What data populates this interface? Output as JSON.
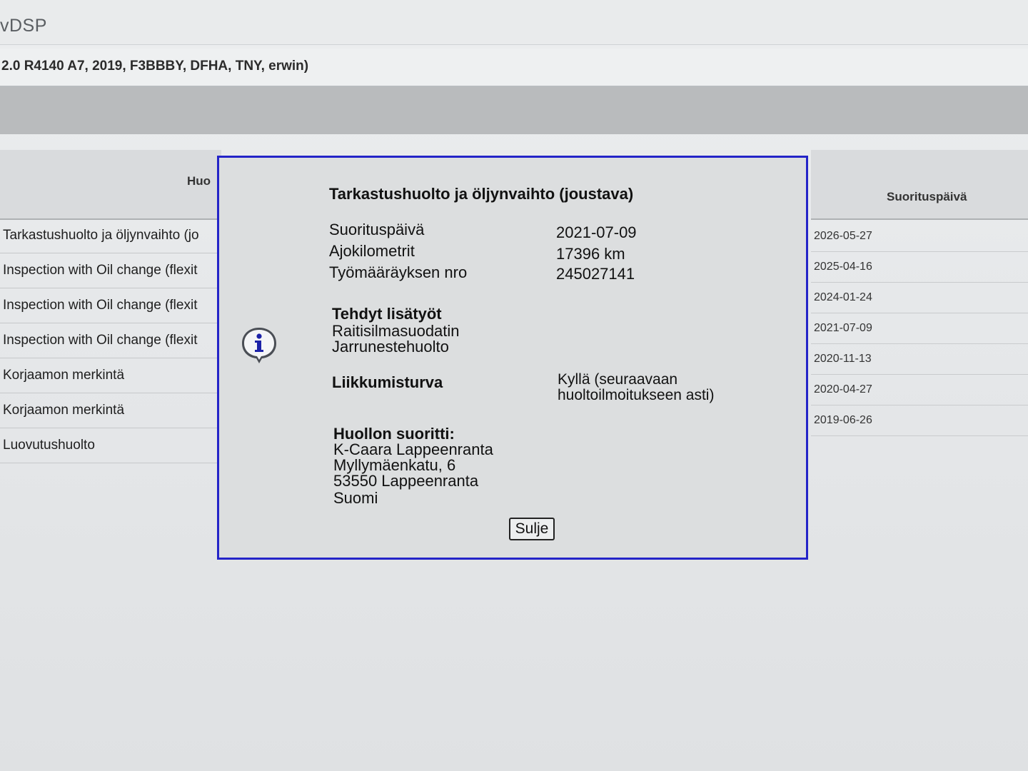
{
  "app": {
    "title": "vDSP"
  },
  "vehicle": {
    "info": "2.0 R4140 A7, 2019, F3BBBY, DFHA, TNY, erwin)"
  },
  "table": {
    "header_left": "Huo",
    "header_right": "Suorituspäivä",
    "rows_left": [
      "Tarkastushuolto ja öljynvaihto (jo",
      "Inspection with Oil change (flexit",
      "Inspection with Oil change (flexit",
      "Inspection with Oil change (flexit",
      "Korjaamon merkintä",
      "Korjaamon merkintä",
      "Luovutushuolto"
    ],
    "dates": [
      "2026-05-27",
      "2025-04-16",
      "2024-01-24",
      "2021-07-09",
      "2020-11-13",
      "2020-04-27",
      "2019-06-26"
    ]
  },
  "dialog": {
    "title": "Tarkastushuolto ja öljynvaihto (joustava)",
    "icon": "info-icon",
    "details": {
      "date_label": "Suorituspäivä",
      "date_value": "2021-07-09",
      "km_label": "Ajokilometrit",
      "km_value": "17396 km",
      "order_label": "Työmääräyksen nro",
      "order_value": "245027141"
    },
    "extras": {
      "heading": "Tehdyt lisätyöt",
      "items": [
        "Raitisilmasuodatin",
        "Jarrunestehuolto"
      ]
    },
    "mobility": {
      "label": "Liikkumisturva",
      "value_line1": "Kyllä (seuraavaan",
      "value_line2": "huoltoilmoitukseen asti)"
    },
    "performer": {
      "heading": "Huollon suoritti:",
      "lines": [
        "K-Caara Lappeenranta",
        "Myllymäenkatu, 6",
        "53550 Lappeenranta",
        "Suomi"
      ]
    },
    "close_label": "Sulje"
  }
}
